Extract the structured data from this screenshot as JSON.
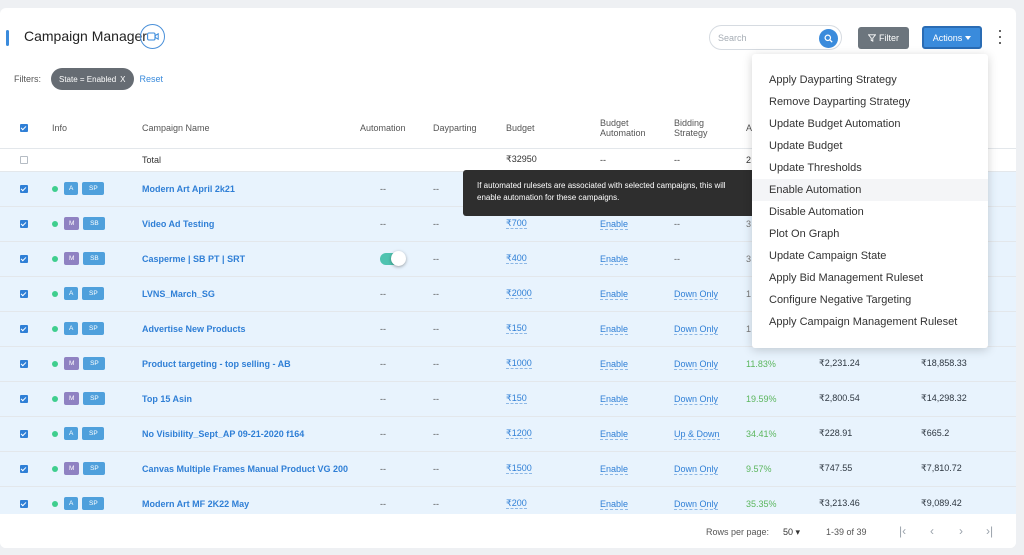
{
  "header": {
    "title": "Campaign Manager",
    "search_placeholder": "Search",
    "filter_label": "Filter",
    "actions_label": "Actions"
  },
  "filters": {
    "label": "Filters:",
    "chip": "State = Enabled",
    "chip_close": "X",
    "reset": "Reset"
  },
  "columns": {
    "info": "Info",
    "name": "Campaign Name",
    "automation": "Automation",
    "dayparting": "Dayparting",
    "budget": "Budget",
    "budget_automation_1": "Budget",
    "budget_automation_2": "Automation",
    "bidding_1": "Bidding",
    "bidding_2": "Strategy",
    "acos_partial": "A"
  },
  "total": {
    "label": "Total",
    "budget": "₹32950",
    "budget_automation": "--",
    "bidding": "--",
    "acos_partial": "2"
  },
  "rows": [
    {
      "type": "A",
      "program": "SP",
      "name": "Modern Art April 2k21",
      "automation": "--",
      "dayparting": "--",
      "budget": "",
      "budget_automation": "",
      "bidding": "",
      "acos": "",
      "spend": "",
      "sales": ""
    },
    {
      "type": "M",
      "program": "SB",
      "name": "Video Ad Testing",
      "automation": "--",
      "dayparting": "--",
      "budget": "₹700",
      "budget_automation": "Enable",
      "bidding": "--",
      "acos": "3",
      "spend": "",
      "sales": ""
    },
    {
      "type": "M",
      "program": "SB",
      "name": "Casperme | SB PT | SRT",
      "automation": "toggle",
      "dayparting": "--",
      "budget": "₹400",
      "budget_automation": "Enable",
      "bidding": "--",
      "acos": "3",
      "spend": "",
      "sales": ""
    },
    {
      "type": "A",
      "program": "SP",
      "name": "LVNS_March_SG",
      "automation": "--",
      "dayparting": "--",
      "budget": "₹2000",
      "budget_automation": "Enable",
      "bidding": "Down Only",
      "acos": "1",
      "spend": "",
      "sales": ""
    },
    {
      "type": "A",
      "program": "SP",
      "name": "Advertise New Products",
      "automation": "--",
      "dayparting": "--",
      "budget": "₹150",
      "budget_automation": "Enable",
      "bidding": "Down Only",
      "acos": "1",
      "spend": "",
      "sales": ""
    },
    {
      "type": "M",
      "program": "SP",
      "name": "Product targeting - top selling - AB",
      "automation": "--",
      "dayparting": "--",
      "budget": "₹1000",
      "budget_automation": "Enable",
      "bidding": "Down Only",
      "acos": "11.83%",
      "spend": "₹2,231.24",
      "sales": "₹18,858.33"
    },
    {
      "type": "M",
      "program": "SP",
      "name": "Top 15 Asin",
      "automation": "--",
      "dayparting": "--",
      "budget": "₹150",
      "budget_automation": "Enable",
      "bidding": "Down Only",
      "acos": "19.59%",
      "spend": "₹2,800.54",
      "sales": "₹14,298.32"
    },
    {
      "type": "A",
      "program": "SP",
      "name": "No Visibility_Sept_AP 09-21-2020 f164",
      "automation": "--",
      "dayparting": "--",
      "budget": "₹1200",
      "budget_automation": "Enable",
      "bidding": "Up & Down",
      "acos": "34.41%",
      "spend": "₹228.91",
      "sales": "₹665.2"
    },
    {
      "type": "M",
      "program": "SP",
      "name": "Canvas Multiple Frames Manual Product VG 200",
      "automation": "--",
      "dayparting": "--",
      "budget": "₹1500",
      "budget_automation": "Enable",
      "bidding": "Down Only",
      "acos": "9.57%",
      "spend": "₹747.55",
      "sales": "₹7,810.72"
    },
    {
      "type": "A",
      "program": "SP",
      "name": "Modern Art MF 2K22 May",
      "automation": "--",
      "dayparting": "--",
      "budget": "₹200",
      "budget_automation": "Enable",
      "bidding": "Down Only",
      "acos": "35.35%",
      "spend": "₹3,213.46",
      "sales": "₹9,089.42"
    }
  ],
  "tooltip": "If automated rulesets are associated with selected campaigns, this will enable automation for these campaigns.",
  "actions_menu": [
    "Apply Dayparting Strategy",
    "Remove Dayparting Strategy",
    "Update Budget Automation",
    "Update Budget",
    "Update Thresholds",
    "Enable Automation",
    "Disable Automation",
    "Plot On Graph",
    "Update Campaign State",
    "Apply Bid Management Ruleset",
    "Configure Negative Targeting",
    "Apply Campaign Management Ruleset"
  ],
  "hovered_menu_index": 5,
  "footer": {
    "rows_per_page_label": "Rows per page:",
    "rows_per_page_value": "50",
    "range": "1-39 of 39"
  },
  "colors": {
    "accent": "#3a8bdc",
    "row_selected": "#e8f3fd",
    "enabled_dot": "#3fce8e",
    "positive": "#5bb65d"
  },
  "icons": [
    "video-camera-icon",
    "search-icon",
    "filter-icon",
    "caret-down-icon",
    "more-vertical-icon",
    "first-page-icon",
    "prev-page-icon",
    "next-page-icon",
    "last-page-icon"
  ]
}
